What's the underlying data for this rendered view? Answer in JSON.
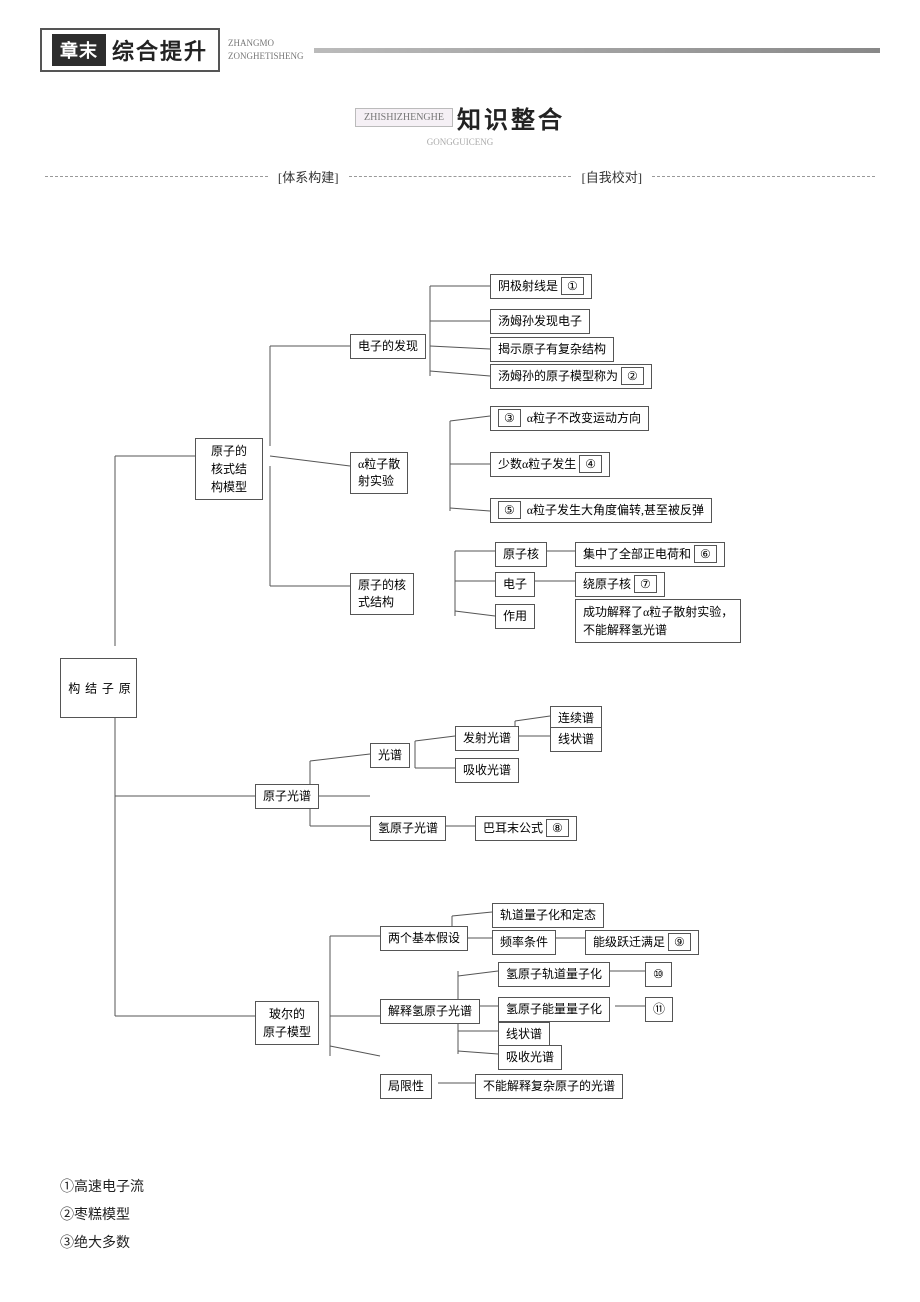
{
  "header": {
    "box_label": "章末",
    "title": "综合提升",
    "sub_line1": "ZHANGMO",
    "sub_line2": "ZONGHETISHENG"
  },
  "section": {
    "badge_top": "ZHISHIZHENGHE",
    "main_title": "知识整合",
    "badge_bottom": "GONGGUICENG"
  },
  "labels": {
    "left": "[体系构建]",
    "right": "[自我校对]"
  },
  "mindmap": {
    "root": "原子结构",
    "nodes": {}
  },
  "footer": {
    "items": [
      "①高速电子流",
      "②枣糕模型",
      "③绝大多数"
    ]
  }
}
